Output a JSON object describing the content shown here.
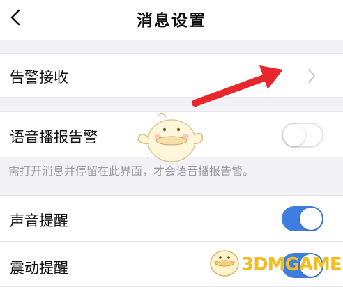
{
  "header": {
    "title": "消息设置",
    "back_icon": "chevron-left-icon"
  },
  "settings": [
    {
      "label": "告警接收",
      "control": "chevron"
    },
    {
      "label": "语音播报告警",
      "control": "toggle",
      "on": false
    },
    {
      "label": "声音提醒",
      "control": "toggle",
      "on": true
    },
    {
      "label": "震动提醒",
      "control": "toggle",
      "on": true
    }
  ],
  "note": "需打开消息并停留在此界面，才会语音播报告警。",
  "colors": {
    "toggle_on": "#3d7fe0",
    "arrow": "#e8262b",
    "background": "#f2f2f6"
  },
  "watermark": {
    "text": "3DMGAME"
  }
}
